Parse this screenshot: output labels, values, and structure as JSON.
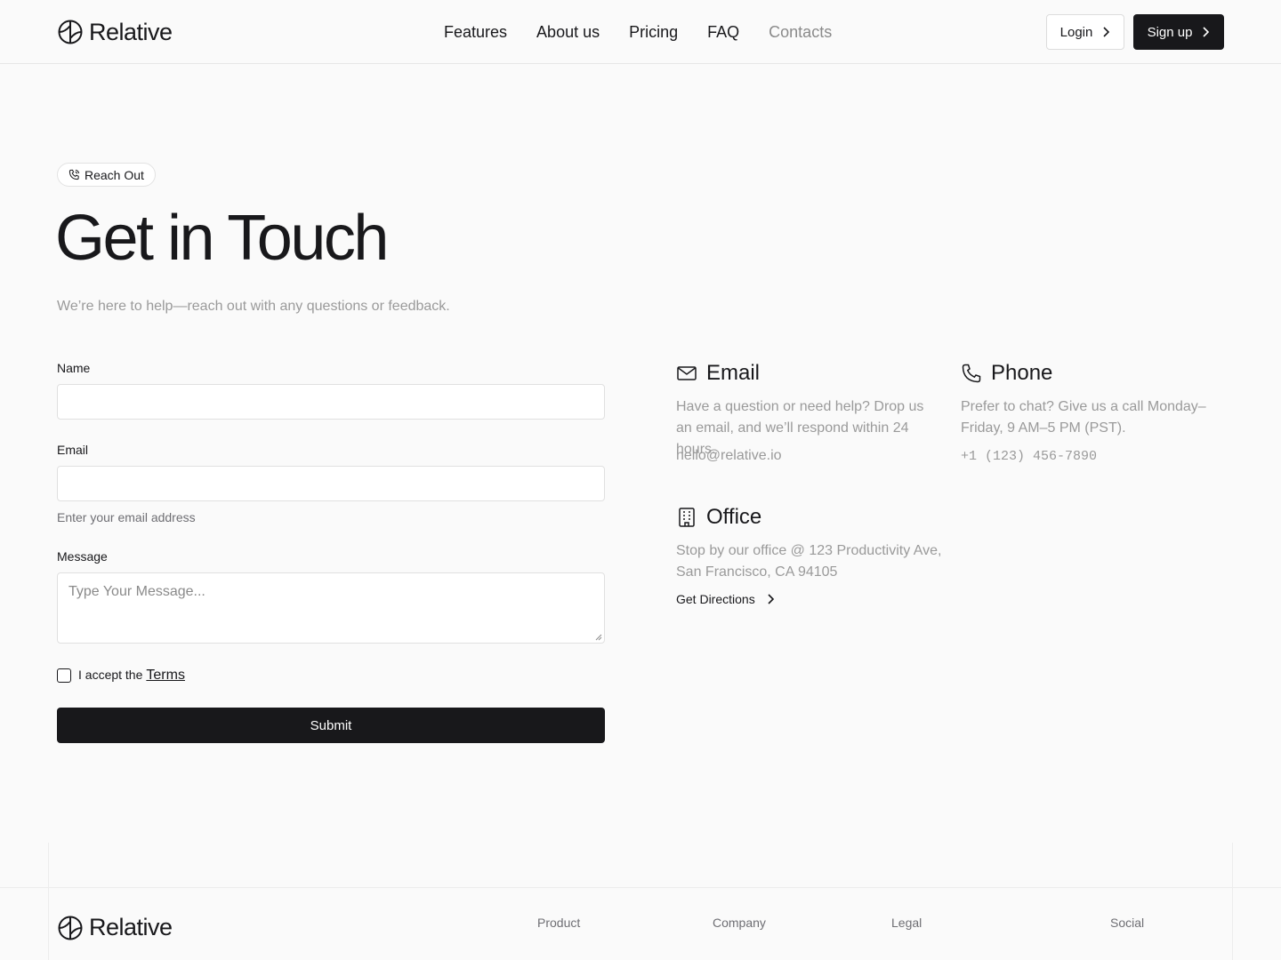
{
  "brand": {
    "name": "Relative"
  },
  "nav": {
    "items": [
      {
        "label": "Features"
      },
      {
        "label": "About us"
      },
      {
        "label": "Pricing"
      },
      {
        "label": "FAQ"
      },
      {
        "label": "Contacts"
      }
    ],
    "login_label": "Login",
    "signup_label": "Sign up"
  },
  "hero": {
    "badge": "Reach Out",
    "title": "Get in Touch",
    "subtitle": "We’re here to help—reach out with any questions or feedback."
  },
  "form": {
    "name_label": "Name",
    "email_label": "Email",
    "email_hint": "Enter your email address",
    "message_label": "Message",
    "message_placeholder": "Type Your Message...",
    "terms_prefix": "I accept the",
    "terms_link": "Terms",
    "submit_label": "Submit"
  },
  "contact": {
    "email": {
      "title": "Email",
      "description": "Have a question or need help? Drop us an email, and we’ll respond within 24 hours.",
      "value": "hello@relative.io"
    },
    "phone": {
      "title": "Phone",
      "description": "Prefer to chat? Give us a call Monday–Friday, 9 AM–5 PM (PST).",
      "value": "+1 (123) 456-7890"
    },
    "office": {
      "title": "Office",
      "description": "Stop by our office @ 123 Productivity Ave, San Francisco, CA 94105",
      "link": "Get Directions"
    }
  },
  "footer": {
    "columns": [
      "Product",
      "Company",
      "Legal",
      "Social"
    ]
  },
  "colors": {
    "primary": "#18181b",
    "muted_text": "#9a9a9a",
    "background": "#fafafa"
  }
}
